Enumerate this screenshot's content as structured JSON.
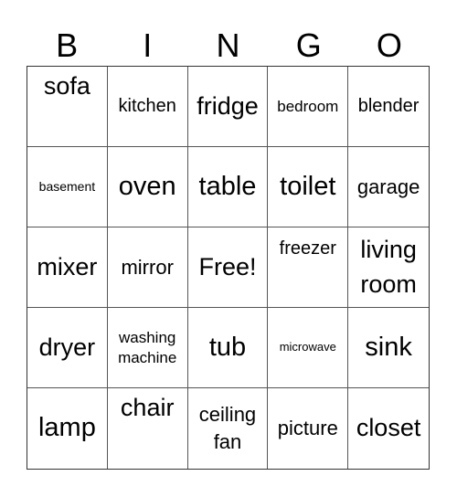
{
  "header": [
    "B",
    "I",
    "N",
    "G",
    "O"
  ],
  "cells": [
    "sofa",
    "kitchen",
    "fridge",
    "bedroom",
    "blender",
    "basement",
    "oven",
    "table",
    "toilet",
    "garage",
    "mixer",
    "mirror",
    "Free!",
    "freezer",
    "living room",
    "dryer",
    "washing machine",
    "tub",
    "microwave",
    "sink",
    "lamp",
    "chair",
    "ceiling fan",
    "picture",
    "closet"
  ]
}
